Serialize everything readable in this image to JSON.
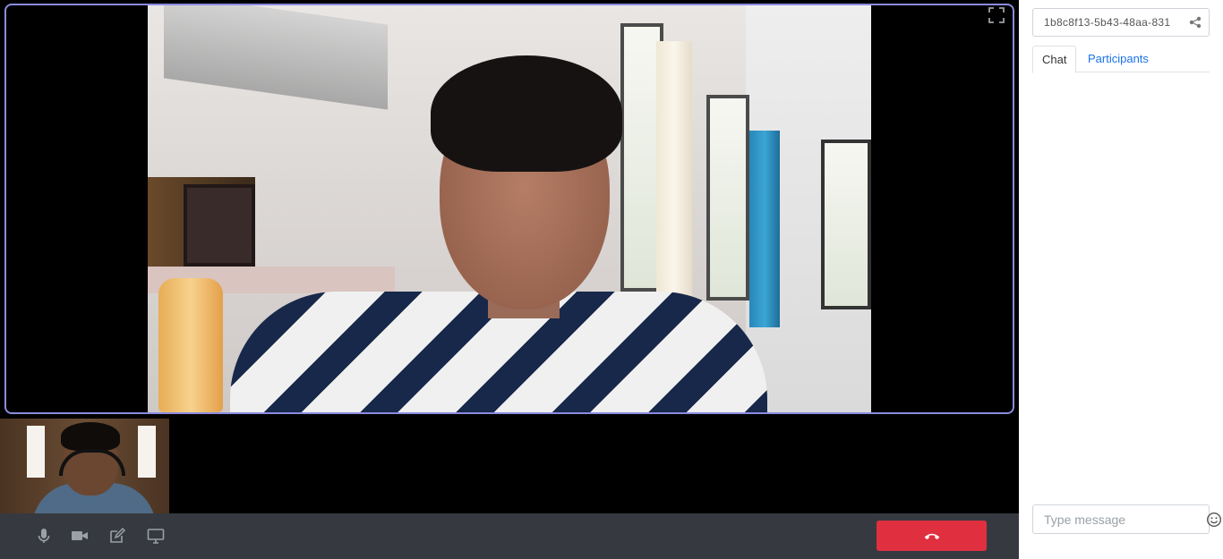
{
  "room": {
    "id": "1b8c8f13-5b43-48aa-831"
  },
  "tabs": [
    {
      "label": "Chat",
      "active": true
    },
    {
      "label": "Participants",
      "active": false
    }
  ],
  "chat": {
    "placeholder": "Type message",
    "messages": []
  },
  "icons": {
    "fullscreen": "fullscreen-icon",
    "share": "share-icon",
    "microphone": "microphone-icon",
    "camera": "video-camera-icon",
    "whiteboard": "edit-icon",
    "screen_share": "monitor-icon",
    "end_call": "phone-hangup-icon",
    "emoji": "smiley-icon"
  },
  "colors": {
    "main_video_border": "#8b8be0",
    "control_bar": "#363a40",
    "end_call": "#e0303f",
    "active_tab_text": "#333333",
    "inactive_tab_text": "#1a73e8"
  }
}
